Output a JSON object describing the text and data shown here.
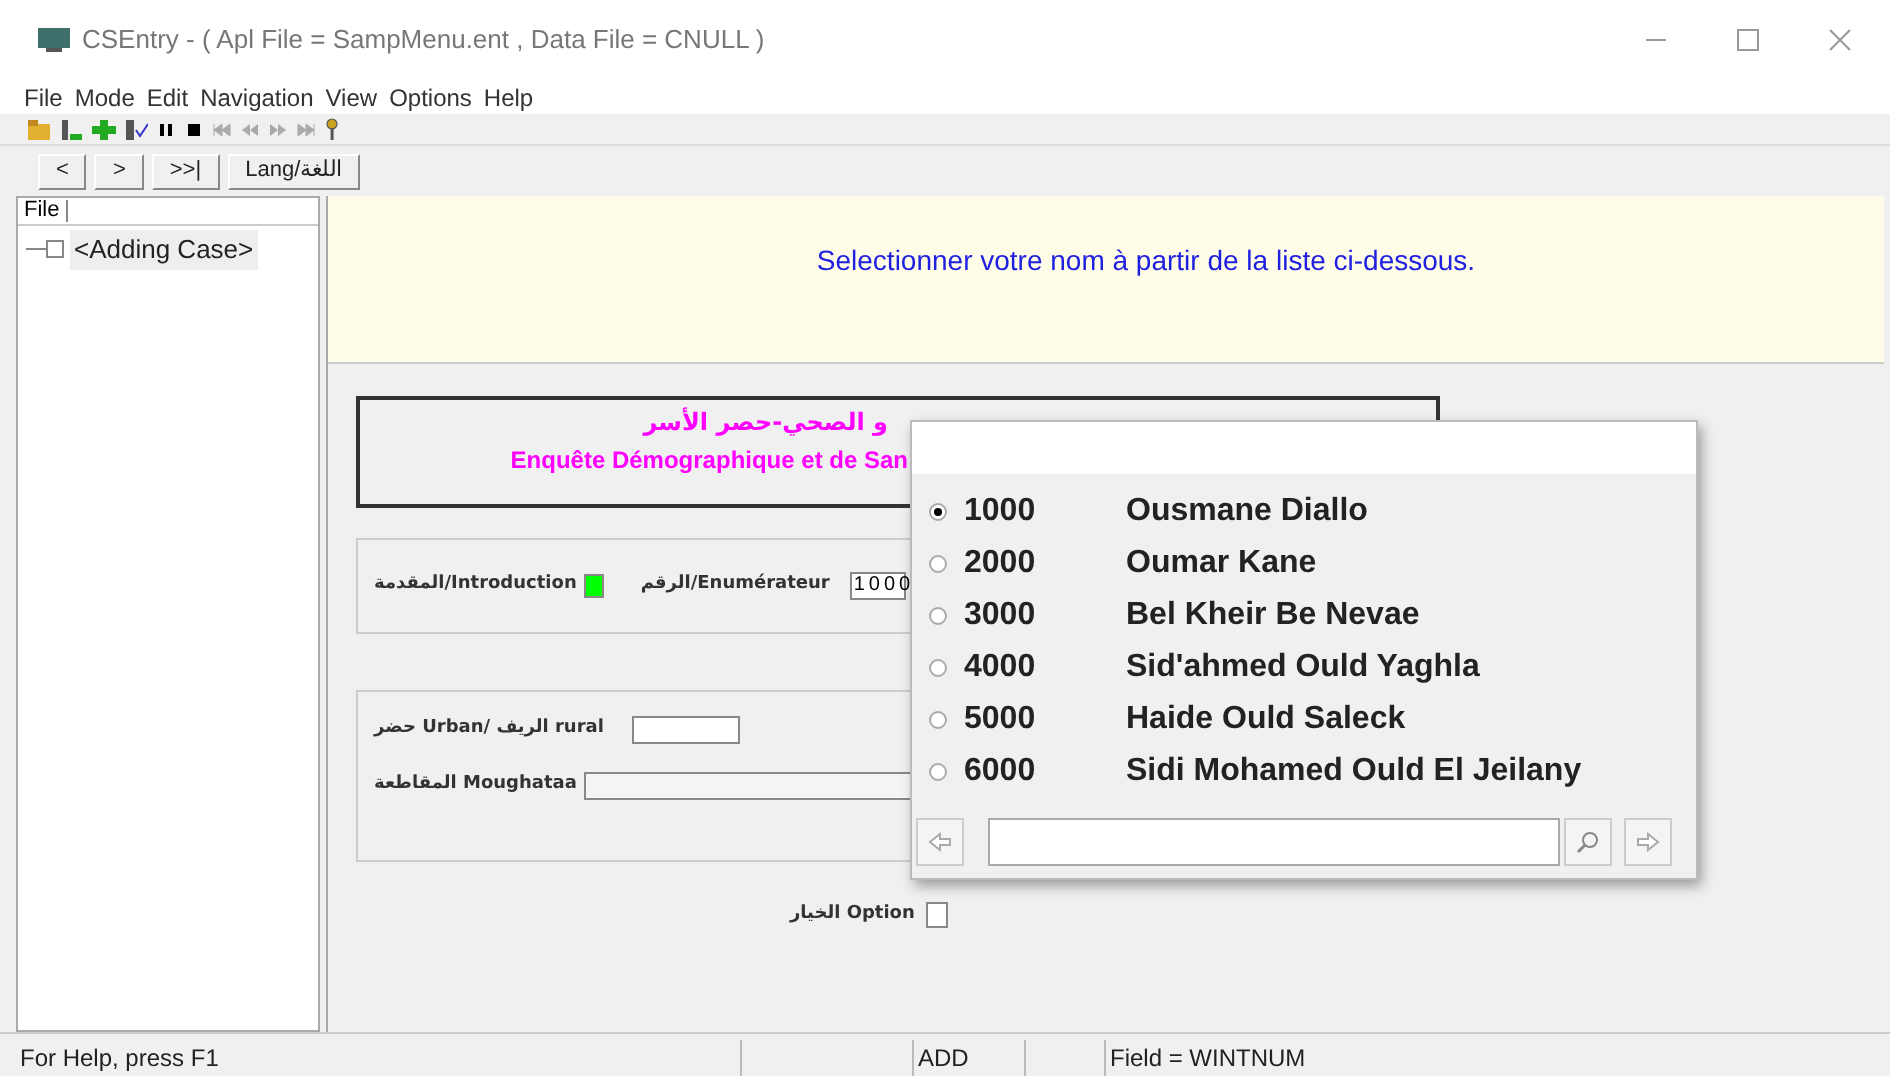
{
  "window": {
    "title": "CSEntry - ( Apl File = SampMenu.ent , Data File = CNULL )"
  },
  "menu": [
    "File",
    "Mode",
    "Edit",
    "Navigation",
    "View",
    "Options",
    "Help"
  ],
  "nav_buttons": [
    "<",
    ">",
    ">>|",
    "Lang/اللغة"
  ],
  "tree": {
    "header": "File",
    "items": [
      {
        "label": "<Adding Case>"
      }
    ]
  },
  "prompt": "Selectionner votre nom à partir de la liste ci-dessous.",
  "form": {
    "title_lines": [
      "و الصحي-حصر الأسر",
      "Enquête Démographique et de San"
    ],
    "groups": [
      {
        "fields": [
          {
            "kind": "marker",
            "label": "المقدمة/Introduction"
          },
          {
            "kind": "digits",
            "label": "الرقم/Enumérateur",
            "value": "1000"
          }
        ]
      },
      {
        "fields": [
          {
            "kind": "digits",
            "label": "حضر Urban/ الريف rural"
          },
          {
            "kind": "text",
            "label": "المقاطعة Moughataa"
          }
        ]
      }
    ],
    "option": {
      "kind": "checkbox",
      "label": "الخيار Option",
      "checked": false
    }
  },
  "popup": {
    "options": [
      {
        "code": "1000",
        "name": "Ousmane Diallo",
        "selected": true
      },
      {
        "code": "2000",
        "name": "Oumar Kane",
        "selected": false
      },
      {
        "code": "3000",
        "name": "Bel Kheir Be Nevae",
        "selected": false
      },
      {
        "code": "4000",
        "name": "Sid'ahmed Ould Yaghla",
        "selected": false
      },
      {
        "code": "5000",
        "name": "Haide Ould Saleck",
        "selected": false
      },
      {
        "code": "6000",
        "name": "Sidi Mohamed Ould El Jeilany",
        "selected": false
      }
    ]
  },
  "status_bar": {
    "help": "For Help, press F1",
    "mode": "ADD",
    "field": "Field = WINTNUM"
  }
}
